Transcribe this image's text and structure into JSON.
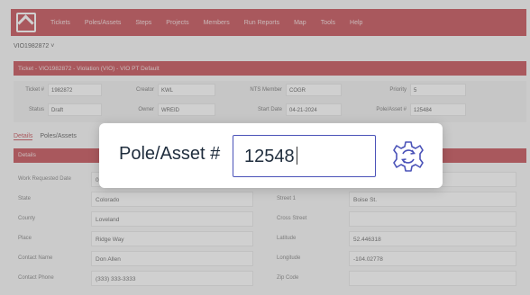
{
  "nav": {
    "items": [
      "Tickets",
      "Poles/Assets",
      "Steps",
      "Projects",
      "Members",
      "Run Reports",
      "Map",
      "Tools",
      "Help"
    ]
  },
  "breadcrumb": "VIO1982872 ˅",
  "ticket_bar": "Ticket - VIO1982872 - Violation (VIO) - VIO PT Default",
  "info": {
    "row1": [
      {
        "label": "Ticket #",
        "value": "1982872"
      },
      {
        "label": "Creator",
        "value": "KWL"
      },
      {
        "label": "NTS Member",
        "value": "COGR"
      },
      {
        "label": "Priority",
        "value": "5"
      }
    ],
    "row2": [
      {
        "label": "Status",
        "value": "Draft"
      },
      {
        "label": "Owner",
        "value": "WREID"
      },
      {
        "label": "Start Date",
        "value": "04-21-2024"
      },
      {
        "label": "Pole/Asset #",
        "value": "125484"
      }
    ]
  },
  "tabs": [
    "Details",
    "Poles/Assets"
  ],
  "details_header": "Details",
  "form": {
    "left": [
      {
        "label": "Work Requested Date",
        "value": "0"
      },
      {
        "label": "State",
        "value": "Colorado"
      },
      {
        "label": "County",
        "value": "Loveland"
      },
      {
        "label": "Place",
        "value": "Ridge Way"
      },
      {
        "label": "Contact Name",
        "value": "Don Allen"
      },
      {
        "label": "Contact Phone",
        "value": "(333) 333-3333"
      }
    ],
    "right": [
      {
        "label": "",
        "value": ""
      },
      {
        "label": "Street 1",
        "value": "Boise St."
      },
      {
        "label": "Cross Street",
        "value": ""
      },
      {
        "label": "Latitude",
        "value": "52.446318"
      },
      {
        "label": "Longitude",
        "value": "-104.02778"
      },
      {
        "label": "Zip Code",
        "value": ""
      }
    ]
  },
  "popup": {
    "label": "Pole/Asset #",
    "value": "12548",
    "icon": "gear-refresh-icon",
    "accent": "#4a52b8"
  },
  "colors": {
    "brand": "#b8262e"
  }
}
